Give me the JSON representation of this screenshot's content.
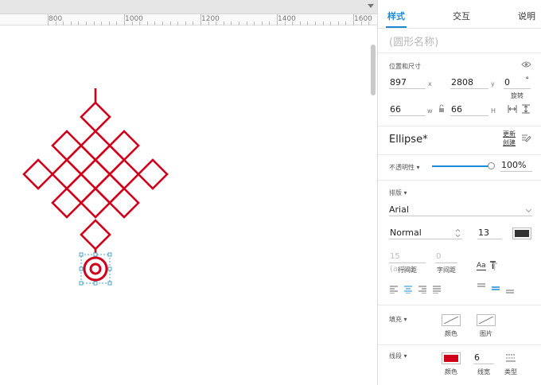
{
  "ruler": {
    "marks": [
      "800",
      "1000",
      "1200",
      "1400",
      "1600"
    ]
  },
  "tabs": [
    {
      "label": "样式"
    },
    {
      "label": "交互"
    },
    {
      "label": "说明"
    }
  ],
  "shape_name_placeholder": "(圆形名称)",
  "position": {
    "title": "位置和尺寸",
    "x_value": "897",
    "x_label": "x",
    "y_value": "2808",
    "y_label": "y",
    "rotation_value": "0",
    "rotation_unit": "°",
    "rotation_label": "旋转",
    "w_value": "66",
    "w_label": "w",
    "h_value": "66",
    "h_label": "H"
  },
  "shape_type": "Ellipse*",
  "update_create": {
    "line1": "更新",
    "line2": "创建"
  },
  "opacity": {
    "label": "不透明性",
    "value": "100%",
    "level": 1.0
  },
  "typography": {
    "title": "排版",
    "font_family": "Arial",
    "font_weight": "Normal",
    "font_size": "13",
    "line_spacing_value": "15 (auto)",
    "line_spacing_label": "行间距",
    "char_spacing_value": "0",
    "char_spacing_label": "字间距",
    "font_color": "#333333"
  },
  "fill": {
    "title": "填充",
    "color_label": "颜色",
    "image_label": "图片"
  },
  "border": {
    "title": "线段",
    "color_label": "颜色",
    "width_value": "6",
    "width_label": "线宽",
    "type_label": "类型",
    "color": "#d0021b"
  },
  "colors": {
    "accent": "#1a8ad6",
    "shape_red": "#d0021b",
    "selection": "#4aa3c8"
  }
}
